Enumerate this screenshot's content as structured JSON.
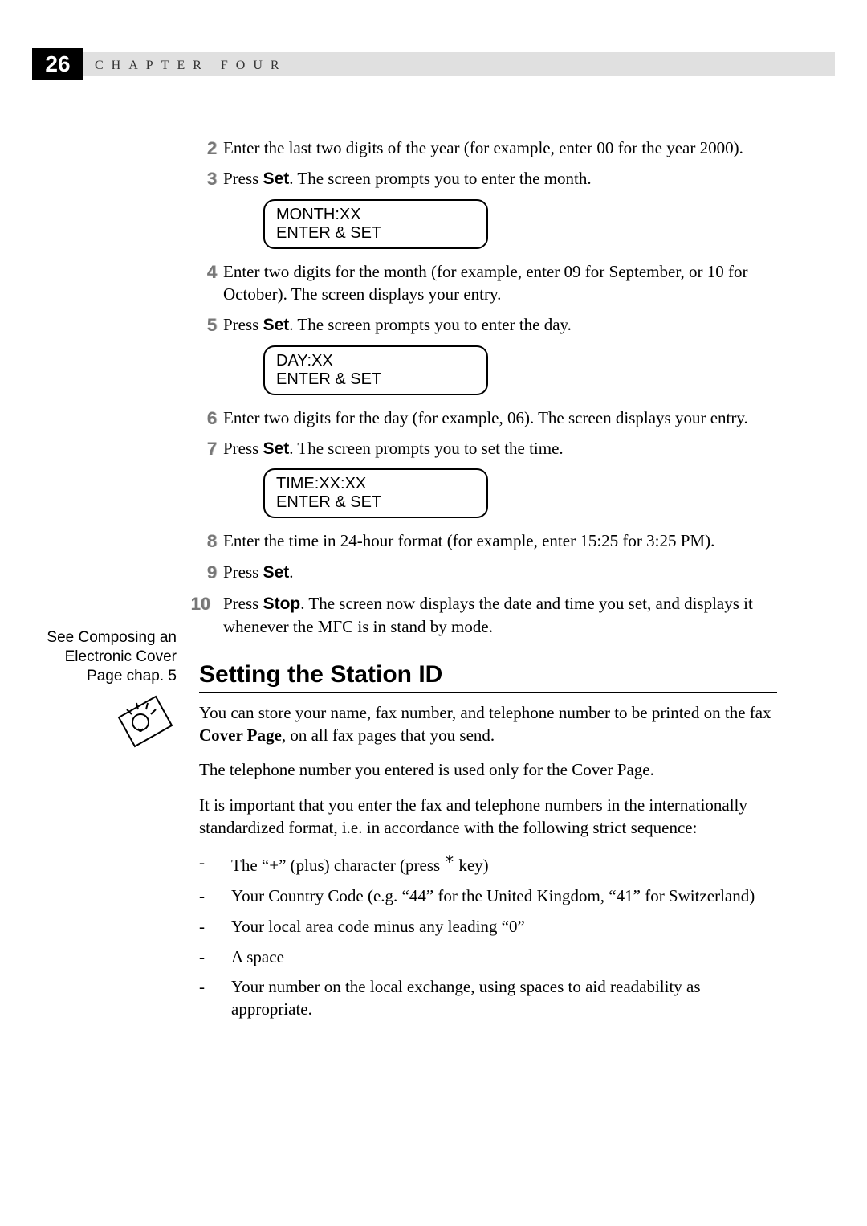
{
  "header": {
    "page_number": "26",
    "chapter_label": "CHAPTER FOUR"
  },
  "steps": {
    "s2": {
      "num": "2",
      "text_a": "Enter the last two digits of the year (for example, enter 00 for the year 2000)."
    },
    "s3": {
      "num": "3",
      "text_a": "Press ",
      "set": "Set",
      "text_b": ". The screen prompts you to enter the month."
    },
    "lcd1": {
      "line1": "MONTH:XX",
      "line2": "ENTER & SET"
    },
    "s4": {
      "num": "4",
      "text_a": "Enter two digits for the month (for example, enter 09 for September, or 10 for October). The screen displays your entry."
    },
    "s5": {
      "num": "5",
      "text_a": "Press ",
      "set": "Set",
      "text_b": ". The screen prompts you to enter  the day."
    },
    "lcd2": {
      "line1": "DAY:XX",
      "line2": "ENTER & SET"
    },
    "s6": {
      "num": "6",
      "text_a": "Enter two digits for the day (for example, 06). The screen displays your entry."
    },
    "s7": {
      "num": "7",
      "text_a": "Press ",
      "set": "Set",
      "text_b": ". The screen prompts you to set the time."
    },
    "lcd3": {
      "line1": "TIME:XX:XX",
      "line2": "ENTER & SET"
    },
    "s8": {
      "num": "8",
      "text_a": "Enter the time in 24-hour format (for example, enter 15:25 for 3:25 PM)."
    },
    "s9": {
      "num": "9",
      "text_a": "Press ",
      "set": "Set",
      "text_b": "."
    },
    "s10": {
      "num": "10",
      "text_a": "Press ",
      "stop": "Stop",
      "text_b": ". The screen now displays the date and time you set, and displays it whenever the MFC is in stand by mode."
    }
  },
  "sidebar": {
    "text": "See Composing an Electronic Cover Page chap. 5"
  },
  "section": {
    "title": "Setting the Station ID",
    "p1a": "You can store your name, fax number, and telephone number to be printed on the fax ",
    "p1b": "Cover Page",
    "p1c": ", on all fax pages that you send.",
    "p2": "The telephone number you entered is used only for the Cover Page.",
    "p3": "It is important that you enter the fax and telephone numbers in the internationally standardized format, i.e. in accordance with the following strict sequence:",
    "bullets": {
      "b1a": "The “+” (plus) character (press ",
      "b1star": "*",
      "b1b": "  key)",
      "b2": "Your Country Code (e.g. “44” for the United Kingdom, “41” for Switzerland)",
      "b3": "Your local area code minus any leading “0”",
      "b4": "A space",
      "b5": "Your number on the local exchange, using spaces to aid readability as appropriate."
    }
  }
}
